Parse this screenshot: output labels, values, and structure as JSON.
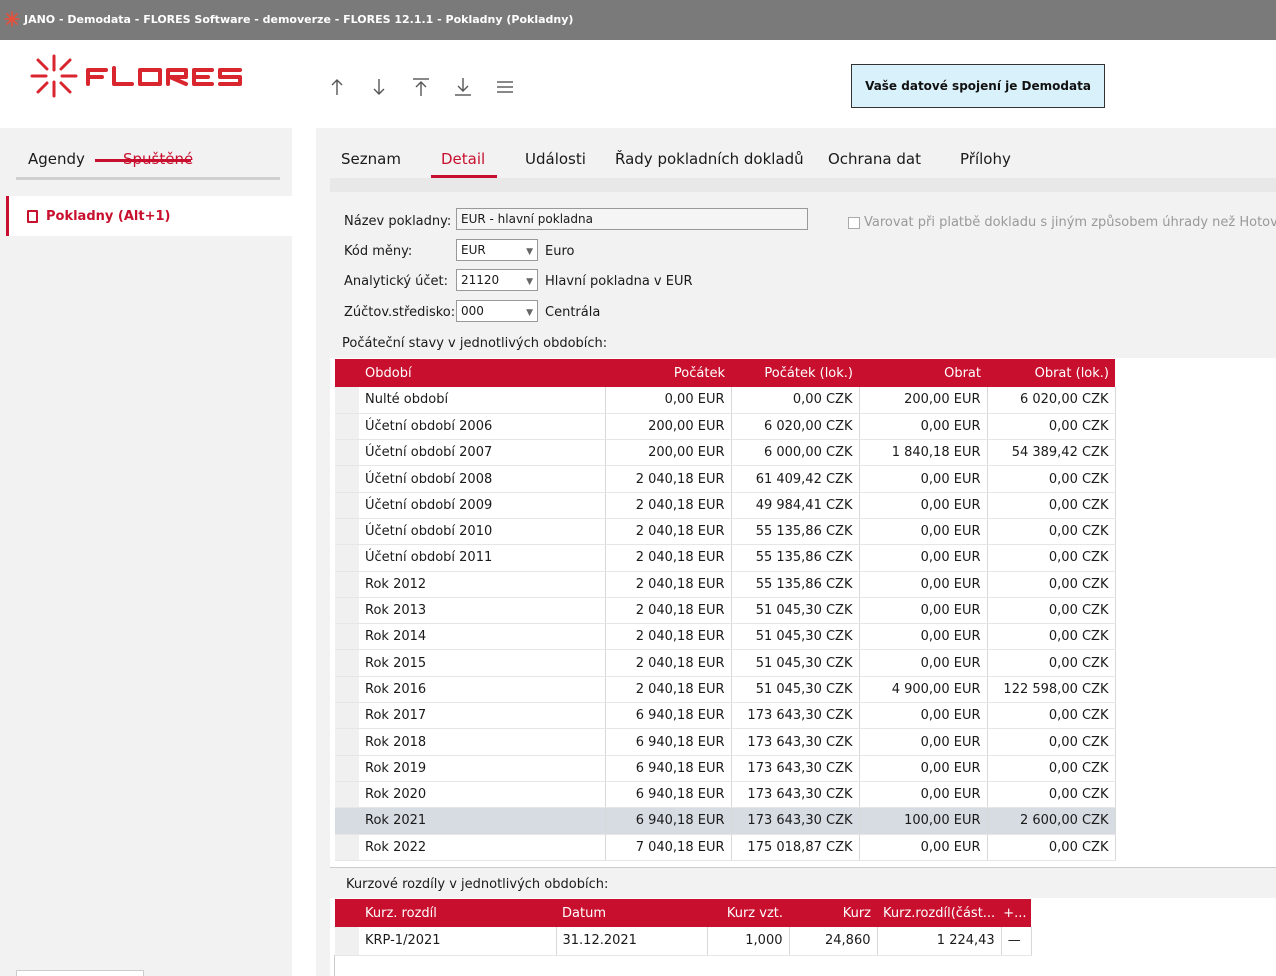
{
  "window": {
    "title": "JANO - Demodata - FLORES Software - demoverze - FLORES 12.1.1 - Pokladny  (Pokladny)"
  },
  "header": {
    "logo_text": "FLORES",
    "connection_label": "Vaše datové spojení je Demodata",
    "nav_icons": [
      "arrow-up-icon",
      "arrow-down-icon",
      "move-to-top-icon",
      "move-to-bottom-icon",
      "menu-icon"
    ]
  },
  "left": {
    "tabs": [
      {
        "label": "Agendy"
      },
      {
        "label": "Spuštěné"
      }
    ],
    "items": [
      {
        "label": "Pokladny (Alt+1)"
      }
    ]
  },
  "main": {
    "tabs": [
      {
        "label": "Seznam"
      },
      {
        "label": "Detail"
      },
      {
        "label": "Události"
      },
      {
        "label": "Řady pokladních dokladů"
      },
      {
        "label": "Ochrana dat"
      },
      {
        "label": "Přílohy"
      }
    ]
  },
  "form": {
    "nazev_label": "Název pokladny:",
    "nazev_value": "EUR - hlavní pokladna",
    "mena_label": "Kód měny:",
    "mena_value": "EUR",
    "mena_desc": "Euro",
    "ucet_label": "Analytický účet:",
    "ucet_value": "21120",
    "ucet_desc": "Hlavní pokladna v EUR",
    "stredisko_label": "Zúčtov.středisko:",
    "stredisko_value": "000",
    "stredisko_desc": "Centrála",
    "warn_checkbox_label": "Varovat při platbě dokladu s jiným způsobem úhrady než Hotove",
    "warn_checked": false
  },
  "pocatecni": {
    "label": "Počáteční stavy v jednotlivých obdobích:",
    "columns": [
      "Období",
      "Počátek",
      "Počátek (lok.)",
      "Obrat",
      "Obrat (lok.)"
    ],
    "rows": [
      [
        "Nulté období",
        "0,00 EUR",
        "0,00 CZK",
        "200,00 EUR",
        "6 020,00 CZK"
      ],
      [
        "Účetní období 2006",
        "200,00 EUR",
        "6 020,00 CZK",
        "0,00 EUR",
        "0,00 CZK"
      ],
      [
        "Účetní období 2007",
        "200,00 EUR",
        "6 000,00 CZK",
        "1 840,18 EUR",
        "54 389,42 CZK"
      ],
      [
        "Účetní období 2008",
        "2 040,18 EUR",
        "61 409,42 CZK",
        "0,00 EUR",
        "0,00 CZK"
      ],
      [
        "Účetní období 2009",
        "2 040,18 EUR",
        "49 984,41 CZK",
        "0,00 EUR",
        "0,00 CZK"
      ],
      [
        "Účetní období 2010",
        "2 040,18 EUR",
        "55 135,86 CZK",
        "0,00 EUR",
        "0,00 CZK"
      ],
      [
        "Účetní období 2011",
        "2 040,18 EUR",
        "55 135,86 CZK",
        "0,00 EUR",
        "0,00 CZK"
      ],
      [
        "Rok 2012",
        "2 040,18 EUR",
        "55 135,86 CZK",
        "0,00 EUR",
        "0,00 CZK"
      ],
      [
        "Rok 2013",
        "2 040,18 EUR",
        "51 045,30 CZK",
        "0,00 EUR",
        "0,00 CZK"
      ],
      [
        "Rok 2014",
        "2 040,18 EUR",
        "51 045,30 CZK",
        "0,00 EUR",
        "0,00 CZK"
      ],
      [
        "Rok 2015",
        "2 040,18 EUR",
        "51 045,30 CZK",
        "0,00 EUR",
        "0,00 CZK"
      ],
      [
        "Rok 2016",
        "2 040,18 EUR",
        "51 045,30 CZK",
        "4 900,00 EUR",
        "122 598,00 CZK"
      ],
      [
        "Rok 2017",
        "6 940,18 EUR",
        "173 643,30 CZK",
        "0,00 EUR",
        "0,00 CZK"
      ],
      [
        "Rok 2018",
        "6 940,18 EUR",
        "173 643,30 CZK",
        "0,00 EUR",
        "0,00 CZK"
      ],
      [
        "Rok 2019",
        "6 940,18 EUR",
        "173 643,30 CZK",
        "0,00 EUR",
        "0,00 CZK"
      ],
      [
        "Rok 2020",
        "6 940,18 EUR",
        "173 643,30 CZK",
        "0,00 EUR",
        "0,00 CZK"
      ],
      [
        "Rok 2021",
        "6 940,18 EUR",
        "173 643,30 CZK",
        "100,00 EUR",
        "2 600,00 CZK"
      ],
      [
        "Rok 2022",
        "7 040,18 EUR",
        "175 018,87 CZK",
        "0,00 EUR",
        "0,00 CZK"
      ]
    ],
    "selected_row": 16
  },
  "kurzove": {
    "label": "Kurzové rozdíly v jednotlivých obdobích:",
    "columns": [
      "Kurz. rozdíl",
      "Datum",
      "Kurz vzt.",
      "Kurz",
      "Kurz.rozdíl(část...",
      "+..."
    ],
    "rows": [
      [
        "KRP-1/2021",
        "31.12.2021",
        "1,000",
        "24,860",
        "1 224,43",
        "—"
      ]
    ]
  },
  "colors": {
    "accent": "#c8102e",
    "titlebar": "#7a7a7a",
    "connection_bg": "#d9f1fb",
    "panel_bg": "#f2f2f2",
    "selected_row": "#d7dce3"
  }
}
